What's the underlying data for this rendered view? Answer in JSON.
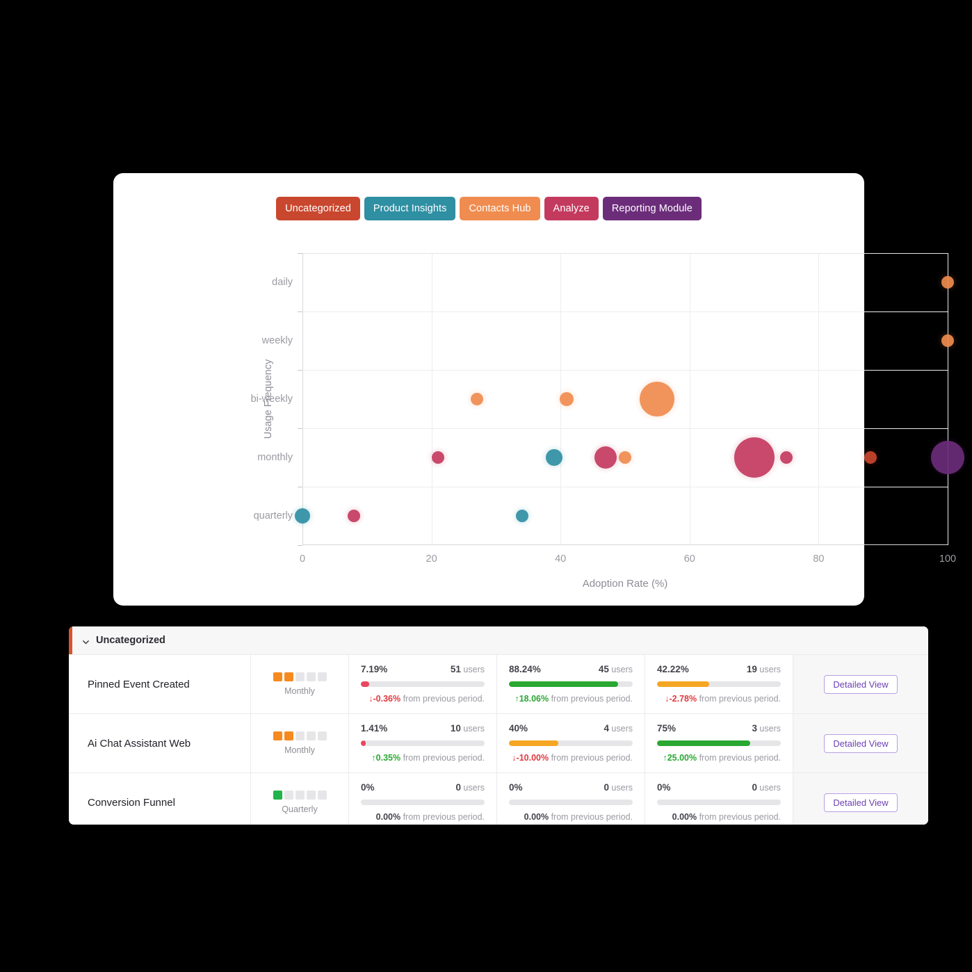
{
  "legend": {
    "items": [
      {
        "label": "Uncategorized",
        "color": "#c9472e"
      },
      {
        "label": "Product Insights",
        "color": "#2f8fa3"
      },
      {
        "label": "Contacts Hub",
        "color": "#f08c4f"
      },
      {
        "label": "Analyze",
        "color": "#c43a5f"
      },
      {
        "label": "Reporting Module",
        "color": "#6b2d7a"
      }
    ]
  },
  "chart_data": {
    "type": "scatter",
    "title": "",
    "xlabel": "Adoption Rate (%)",
    "ylabel": "Usage Frequency",
    "xlim": [
      0,
      100
    ],
    "xticks": [
      0,
      20,
      40,
      60,
      80,
      100
    ],
    "yticks": [
      "daily",
      "weekly",
      "bi-weekly",
      "monthly",
      "quarterly"
    ],
    "grid": true,
    "legend_position": "top-center",
    "series": [
      {
        "name": "Uncategorized",
        "color": "#c9472e",
        "points": [
          {
            "x": 88,
            "y": "monthly",
            "size": 9
          }
        ]
      },
      {
        "name": "Product Insights",
        "color": "#2f8fa3",
        "points": [
          {
            "x": 0,
            "y": "quarterly",
            "size": 11
          },
          {
            "x": 34,
            "y": "quarterly",
            "size": 9
          },
          {
            "x": 39,
            "y": "monthly",
            "size": 12
          }
        ]
      },
      {
        "name": "Contacts Hub",
        "color": "#f08c4f",
        "points": [
          {
            "x": 100,
            "y": "daily",
            "size": 9
          },
          {
            "x": 100,
            "y": "weekly",
            "size": 9
          },
          {
            "x": 27,
            "y": "bi-weekly",
            "size": 9
          },
          {
            "x": 41,
            "y": "bi-weekly",
            "size": 10
          },
          {
            "x": 55,
            "y": "bi-weekly",
            "size": 25
          },
          {
            "x": 50,
            "y": "monthly",
            "size": 9
          }
        ]
      },
      {
        "name": "Analyze",
        "color": "#c43a5f",
        "points": [
          {
            "x": 8,
            "y": "quarterly",
            "size": 9
          },
          {
            "x": 21,
            "y": "monthly",
            "size": 9
          },
          {
            "x": 47,
            "y": "monthly",
            "size": 16
          },
          {
            "x": 70,
            "y": "monthly",
            "size": 29
          },
          {
            "x": 75,
            "y": "monthly",
            "size": 9
          }
        ]
      },
      {
        "name": "Reporting Module",
        "color": "#6b2d7a",
        "points": [
          {
            "x": 100,
            "y": "monthly",
            "size": 24
          }
        ]
      }
    ]
  },
  "table": {
    "group": {
      "label": "Uncategorized",
      "accent_color": "#d9542b",
      "expanded": true
    },
    "action_label": "Detailed View",
    "users_suffix": "users",
    "delta_suffix": "from previous period.",
    "rows": [
      {
        "name": "Pinned Event Created",
        "frequency": {
          "label": "Monthly",
          "filled": 2,
          "total": 5,
          "color": "#f68a1f"
        },
        "metrics": [
          {
            "percent": "7.19%",
            "users": "51",
            "bar_pct": 7,
            "bar_color": "#e8485e",
            "delta": "-0.36%",
            "direction": "down",
            "delta_color": "#e0393e"
          },
          {
            "percent": "88.24%",
            "users": "45",
            "bar_pct": 88.24,
            "bar_color": "#2aa832",
            "delta": "18.06%",
            "direction": "up",
            "delta_color": "#2aa832"
          },
          {
            "percent": "42.22%",
            "users": "19",
            "bar_pct": 42.22,
            "bar_color": "#f5a623",
            "delta": "-2.78%",
            "direction": "down",
            "delta_color": "#e0393e"
          }
        ]
      },
      {
        "name": "Ai Chat Assistant Web",
        "frequency": {
          "label": "Monthly",
          "filled": 2,
          "total": 5,
          "color": "#f68a1f"
        },
        "metrics": [
          {
            "percent": "1.41%",
            "users": "10",
            "bar_pct": 1.41,
            "bar_color": "#e8485e",
            "delta": "0.35%",
            "direction": "up",
            "delta_color": "#2aa832"
          },
          {
            "percent": "40%",
            "users": "4",
            "bar_pct": 40,
            "bar_color": "#f5a623",
            "delta": "-10.00%",
            "direction": "down",
            "delta_color": "#e0393e"
          },
          {
            "percent": "75%",
            "users": "3",
            "bar_pct": 75,
            "bar_color": "#2aa832",
            "delta": "25.00%",
            "direction": "up",
            "delta_color": "#2aa832"
          }
        ]
      },
      {
        "name": "Conversion Funnel",
        "frequency": {
          "label": "Quarterly",
          "filled": 1,
          "total": 5,
          "color": "#21b44b"
        },
        "metrics": [
          {
            "percent": "0%",
            "users": "0",
            "bar_pct": 0,
            "bar_color": "#e6e6e9",
            "delta": "0.00%",
            "direction": "none",
            "delta_color": "#43434b"
          },
          {
            "percent": "0%",
            "users": "0",
            "bar_pct": 0,
            "bar_color": "#e6e6e9",
            "delta": "0.00%",
            "direction": "none",
            "delta_color": "#43434b"
          },
          {
            "percent": "0%",
            "users": "0",
            "bar_pct": 0,
            "bar_color": "#e6e6e9",
            "delta": "0.00%",
            "direction": "none",
            "delta_color": "#43434b"
          }
        ]
      }
    ]
  }
}
